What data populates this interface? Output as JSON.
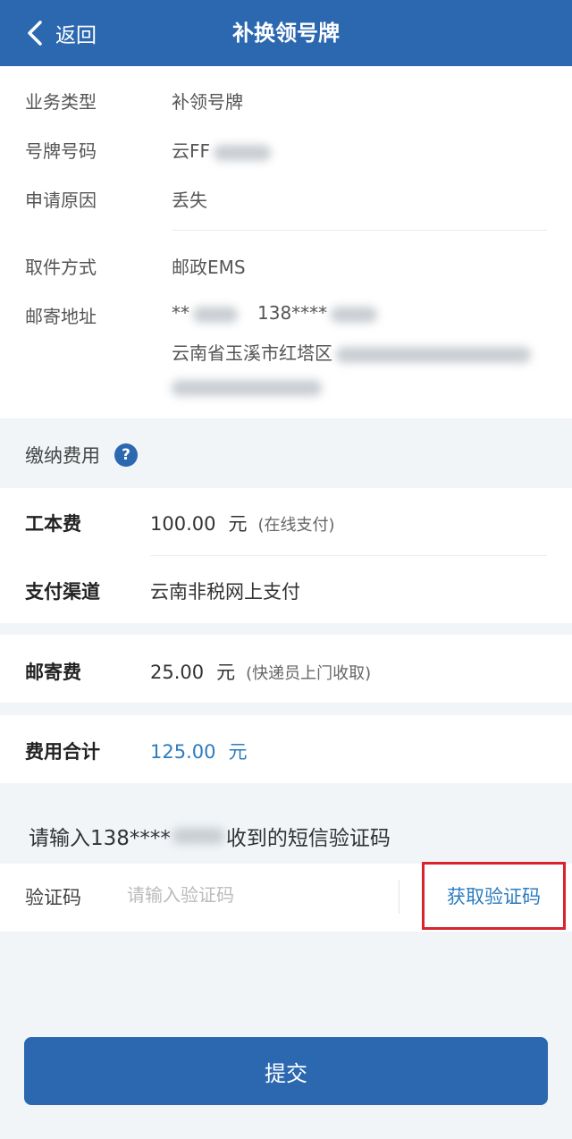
{
  "header": {
    "back_label": "返回",
    "title": "补换领号牌"
  },
  "business": {
    "type_label": "业务类型",
    "type_value": "补领号牌",
    "plate_label": "号牌号码",
    "plate_value": "云FF",
    "reason_label": "申请原因",
    "reason_value": "丢失"
  },
  "delivery": {
    "method_label": "取件方式",
    "method_value": "邮政EMS",
    "address_label": "邮寄地址",
    "recipient_prefix": "**",
    "phone_prefix": "138****",
    "address_prefix": "云南省玉溪市红塔区"
  },
  "fees": {
    "section_title": "缴纳费用",
    "help_glyph": "?",
    "cost_label": "工本费",
    "cost_amount": "100.00",
    "cost_unit": "元",
    "cost_note": "(在线支付)",
    "channel_label": "支付渠道",
    "channel_value": "云南非税网上支付",
    "postage_label": "邮寄费",
    "postage_amount": "25.00",
    "postage_unit": "元",
    "postage_note": "(快递员上门收取)",
    "total_label": "费用合计",
    "total_amount": "125.00",
    "total_unit": "元"
  },
  "verify": {
    "prompt_prefix": "请输入138****",
    "prompt_suffix": "收到的短信验证码",
    "code_label": "验证码",
    "code_placeholder": "请输入验证码",
    "code_value": "",
    "get_code_label": "获取验证码"
  },
  "submit_label": "提交",
  "colors": {
    "brand": "#2c68b0",
    "link": "#2c7cbf",
    "highlight_border": "#d9232d",
    "background": "#f1f5f8"
  }
}
